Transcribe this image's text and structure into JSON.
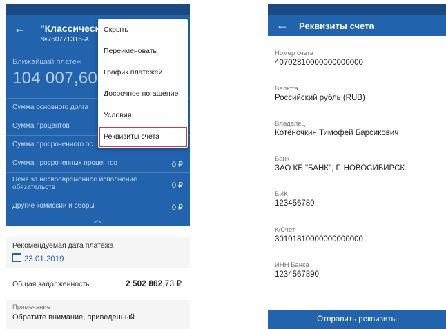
{
  "left": {
    "title": "\"Классически",
    "account_number": "№760771315-A",
    "next_payment_label": "Ближайший платеж",
    "next_payment_amount": "104 007,60",
    "rows": [
      {
        "label": "Сумма основного долга",
        "value": ""
      },
      {
        "label": "Сумма процентов",
        "value": ""
      },
      {
        "label": "Сумма просроченного ос",
        "value": ""
      },
      {
        "label": "Сумма просроченных процентов",
        "value": "0 ₽"
      },
      {
        "label": "Пеня за несвоевременное исполнение обязательств",
        "value": "0 ₽"
      },
      {
        "label": "Другие комиссии и сборы",
        "value": "0 ₽"
      }
    ],
    "recommended_date_label": "Рекомендуемая дата платежа",
    "recommended_date_value": "23.01.2019",
    "total_debt_label": "Общая задолженность",
    "total_debt_main": "2 502 862",
    "total_debt_cents": ",73 ₽",
    "note_label": "Примечание",
    "note_text": "Обратите внимание, приведенный"
  },
  "menu": {
    "items": [
      "Скрыть",
      "Переименовать",
      "График платежей",
      "Досрочное погашение",
      "Условия",
      "Реквизиты счета"
    ],
    "highlighted_index": 5
  },
  "right": {
    "title": "Реквизиты счета",
    "fields": [
      {
        "label": "Номер счета",
        "value": "40702810000000000000"
      },
      {
        "label": "Валюта",
        "value": "Российский рубль (RUB)"
      },
      {
        "label": "Владелец",
        "value": "Котёночкин Тимофей Барсикович"
      },
      {
        "label": "Банк",
        "value": "ЗАО КБ \"БАНК\", Г. НОВОСИБИРСК"
      },
      {
        "label": "БИК",
        "value": "123456789"
      },
      {
        "label": "К/Счет",
        "value": "30101810000000000000"
      },
      {
        "label": "ИНН Банка",
        "value": "1234567890"
      }
    ],
    "send_button": "Отправить реквизиты"
  },
  "colors": {
    "primary": "#2163ad",
    "statusbar": "#194a82",
    "highlight": "#d23a3a"
  },
  "icons": {
    "back": "arrow-left-icon",
    "chevron": "chevron-up-icon",
    "calendar": "calendar-icon"
  }
}
